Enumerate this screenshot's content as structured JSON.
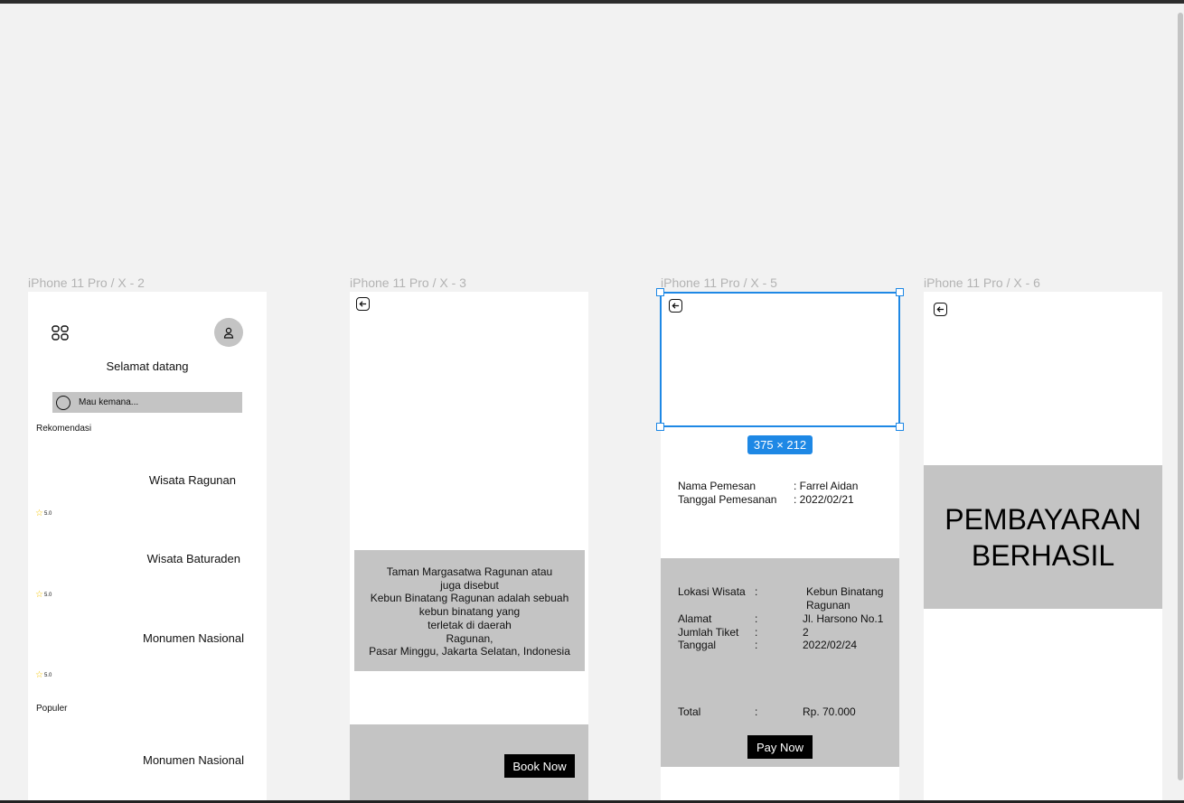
{
  "frames": [
    {
      "label": "iPhone 11 Pro / X - 2"
    },
    {
      "label": "iPhone 11 Pro / X - 3"
    },
    {
      "label": "iPhone 11 Pro / X - 5"
    },
    {
      "label": "iPhone 11 Pro / X - 6"
    }
  ],
  "home": {
    "greeting": "Selamat datang",
    "search_placeholder": "Mau kemana...",
    "section_recommend": "Rekomendasi",
    "items": [
      {
        "title": "Wisata Ragunan",
        "rating": "5.0"
      },
      {
        "title": "Wisata Baturaden",
        "rating": "5.0"
      },
      {
        "title": "Monumen Nasional",
        "rating": "5.0"
      }
    ],
    "section_popular": "Populer",
    "popular_items": [
      {
        "title": "Monumen Nasional"
      }
    ]
  },
  "detail": {
    "description_lines": [
      "Taman Margasatwa Ragunan atau",
      "juga disebut",
      "Kebun Binatang Ragunan adalah sebuah",
      "kebun binatang yang",
      "terletak di daerah",
      "Ragunan,",
      "Pasar Minggu, Jakarta Selatan, Indonesia"
    ],
    "book_button": "Book Now"
  },
  "checkout": {
    "size_badge": "375 × 212",
    "customer": [
      {
        "label": "Nama Pemesan",
        "value": ": Farrel Aidan"
      },
      {
        "label": "Tanggal Pemesanan",
        "value": ": 2022/02/21"
      }
    ],
    "lokasi_label": "Lokasi Wisata",
    "lokasi_colon": ":",
    "lokasi_value_1": "Kebun Binatang",
    "lokasi_value_2": "Ragunan",
    "rows": [
      {
        "label": "Alamat",
        "colon": ":",
        "value": "Jl. Harsono No.1"
      },
      {
        "label": "Jumlah Tiket",
        "colon": ":",
        "value": "2"
      },
      {
        "label": "Tanggal",
        "colon": ":",
        "value": "2022/02/24"
      }
    ],
    "total_label": "Total",
    "total_colon": ":",
    "total_value": "Rp. 70.000",
    "pay_button": "Pay Now"
  },
  "success": {
    "line1": "PEMBAYARAN",
    "line2": "BERHASIL"
  },
  "colors": {
    "canvas": "#f2f2f2",
    "placeholder_grey": "#c4c4c4",
    "selection_blue": "#1e88e5",
    "star": "#f5c400"
  }
}
